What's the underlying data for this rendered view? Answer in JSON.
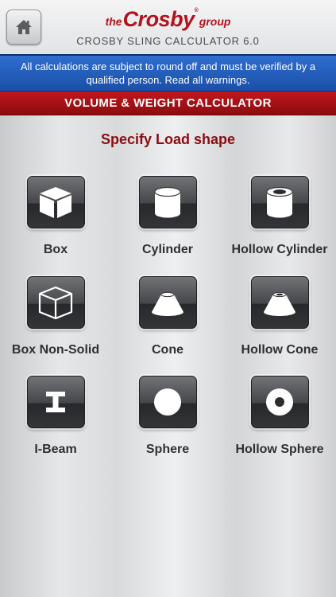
{
  "header": {
    "logo": {
      "prefix": "the",
      "brand": "Crosby",
      "suffix": "group",
      "mark": "®"
    },
    "subtitle": "CROSBY SLING CALCULATOR 6.0",
    "home_icon": "home-icon"
  },
  "warning": {
    "text": "All calculations are subject to round off and must be verified by a qualified person. Read all warnings."
  },
  "section": {
    "title": "VOLUME & WEIGHT CALCULATOR"
  },
  "prompt": "Specify Load shape",
  "shapes": [
    {
      "label": "Box",
      "icon": "box-icon"
    },
    {
      "label": "Cylinder",
      "icon": "cylinder-icon"
    },
    {
      "label": "Hollow Cylinder",
      "icon": "hollow-cylinder-icon"
    },
    {
      "label": "Box Non-Solid",
      "icon": "box-non-solid-icon"
    },
    {
      "label": "Cone",
      "icon": "cone-icon"
    },
    {
      "label": "Hollow Cone",
      "icon": "hollow-cone-icon"
    },
    {
      "label": "I-Beam",
      "icon": "i-beam-icon"
    },
    {
      "label": "Sphere",
      "icon": "sphere-icon"
    },
    {
      "label": "Hollow Sphere",
      "icon": "hollow-sphere-icon"
    }
  ],
  "colors": {
    "brand_red": "#b3121b",
    "warning_blue": "#1a4fa8",
    "section_red": "#a51216",
    "prompt_red": "#8b0d11",
    "tile_dark": "#3a3b3e"
  }
}
